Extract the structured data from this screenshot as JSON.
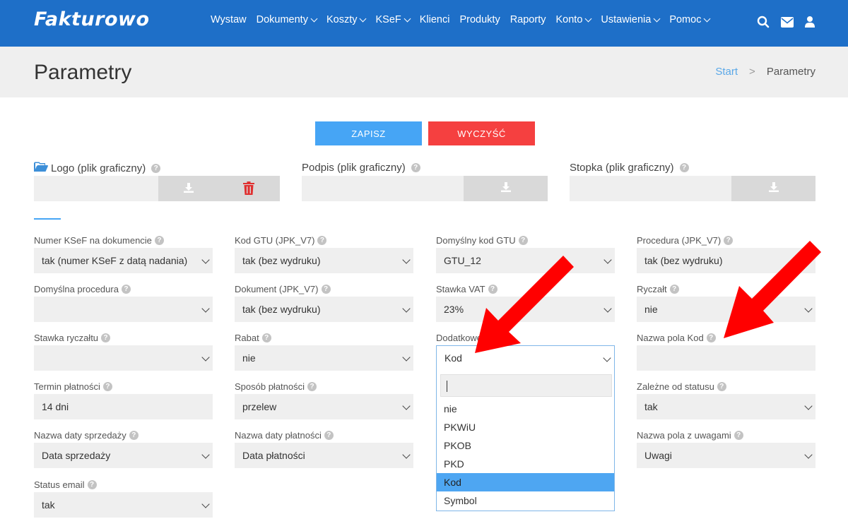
{
  "app": {
    "logo": "Fakturowo"
  },
  "nav": {
    "items": [
      {
        "label": "Wystaw",
        "chevron": false
      },
      {
        "label": "Dokumenty",
        "chevron": true
      },
      {
        "label": "Koszty",
        "chevron": true
      },
      {
        "label": "KSeF",
        "chevron": true
      },
      {
        "label": "Klienci",
        "chevron": false
      },
      {
        "label": "Produkty",
        "chevron": false
      },
      {
        "label": "Raporty",
        "chevron": false
      },
      {
        "label": "Konto",
        "chevron": true
      },
      {
        "label": "Ustawienia",
        "chevron": true
      },
      {
        "label": "Pomoc",
        "chevron": true
      }
    ],
    "icons": [
      "search-icon",
      "envelope-icon",
      "user-icon"
    ]
  },
  "header": {
    "title": "Parametry",
    "breadcrumb": {
      "start": "Start",
      "separator": ">",
      "current": "Parametry"
    }
  },
  "actions": {
    "save": "ZAPISZ",
    "clear": "WYCZYŚĆ"
  },
  "uploads": {
    "logo": "Logo (plik graficzny)",
    "podpis": "Podpis (plik graficzny)",
    "stopka": "Stopka (plik graficzny)"
  },
  "fields": {
    "numer_ksef": {
      "label": "Numer KSeF na dokumencie",
      "value": "tak (numer KSeF z datą nadania)"
    },
    "kod_gtu": {
      "label": "Kod GTU (JPK_V7)",
      "value": "tak (bez wydruku)"
    },
    "domyslny_gtu": {
      "label": "Domyślny kod GTU",
      "value": "GTU_12"
    },
    "procedura": {
      "label": "Procedura (JPK_V7)",
      "value": "tak (bez wydruku)"
    },
    "domyslna_procedura": {
      "label": "Domyślna procedura",
      "value": ""
    },
    "dokument": {
      "label": "Dokument (JPK_V7)",
      "value": "tak (bez wydruku)"
    },
    "stawka_vat": {
      "label": "Stawka VAT",
      "value": "23%"
    },
    "ryczalt": {
      "label": "Ryczałt",
      "value": "nie"
    },
    "stawka_ryczaltu": {
      "label": "Stawka ryczałtu",
      "value": ""
    },
    "rabat": {
      "label": "Rabat",
      "value": "nie"
    },
    "dodatkowe": {
      "label": "Dodatkowe",
      "value": "Kod"
    },
    "nazwa_pola_kod": {
      "label": "Nazwa pola Kod",
      "value": ""
    },
    "termin": {
      "label": "Termin płatności",
      "value": "14 dni"
    },
    "sposob": {
      "label": "Sposób płatności",
      "value": "przelew"
    },
    "zalezne": {
      "label": "Zależne od statusu",
      "value": "tak"
    },
    "nazwa_daty_sprzedazy": {
      "label": "Nazwa daty sprzedaży",
      "value": "Data sprzedaży"
    },
    "nazwa_daty_platnosci": {
      "label": "Nazwa daty płatności",
      "value": "Data płatności"
    },
    "nazwa_pola_uwagi": {
      "label": "Nazwa pola z uwagami",
      "value": "Uwagi"
    },
    "status_email": {
      "label": "Status email",
      "value": "tak"
    }
  },
  "dropdown": {
    "options": [
      "nie",
      "PKWiU",
      "PKOB",
      "PKD",
      "Kod",
      "Symbol"
    ],
    "selected": "Kod"
  },
  "colors": {
    "nav": "#1e6fc8",
    "save": "#46a5f5",
    "clear": "#f54040",
    "arrow": "#ff0000"
  }
}
